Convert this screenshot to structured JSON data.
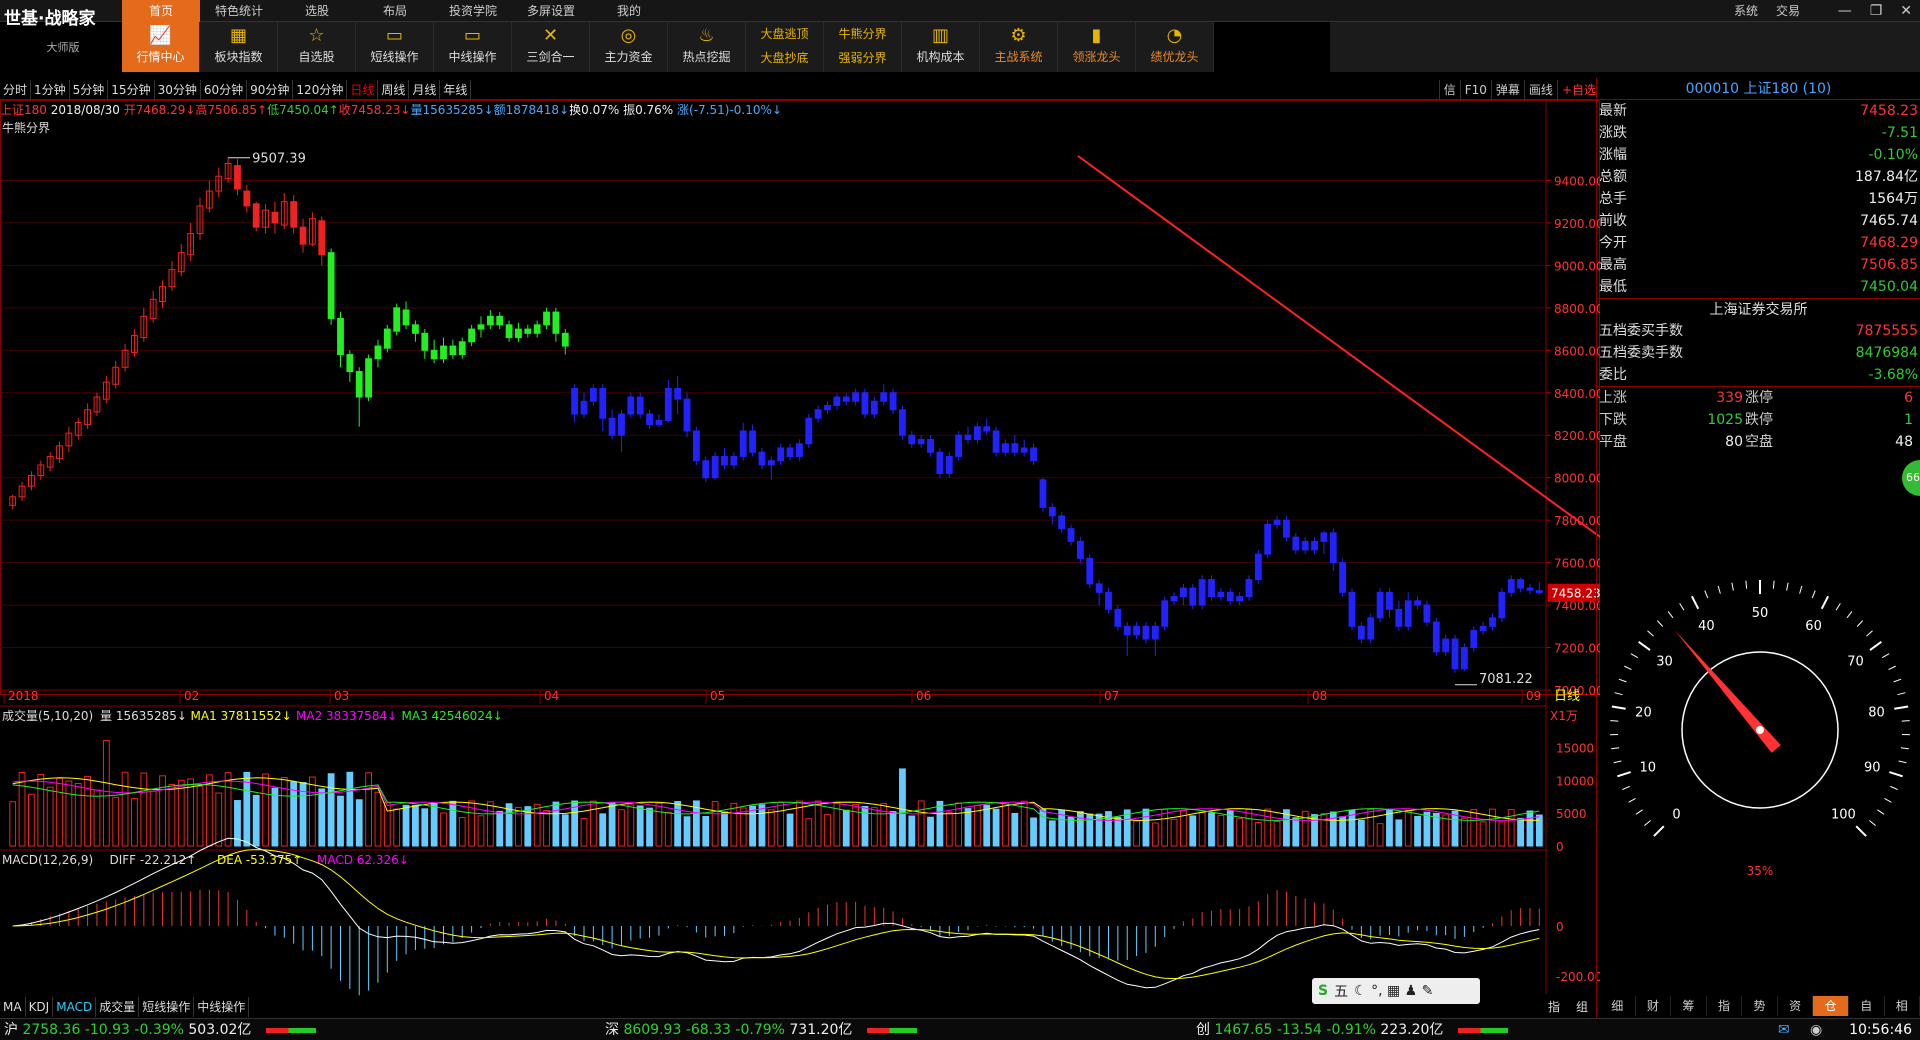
{
  "app": {
    "brand": "世基·战略家",
    "sub": "大师版"
  },
  "menu": [
    "首页",
    "特色统计",
    "选股",
    "布局",
    "投资学院",
    "多屏设置",
    "我的"
  ],
  "right_menu": [
    "系统",
    "交易"
  ],
  "toolbar": [
    {
      "label": "行情中心",
      "icon": "chart-icon",
      "active": true
    },
    {
      "label": "板块指数",
      "icon": "board-icon"
    },
    {
      "label": "自选股",
      "icon": "star-icon"
    },
    {
      "label": "短线操作",
      "icon": "short-icon"
    },
    {
      "label": "中线操作",
      "icon": "mid-icon"
    },
    {
      "label": "三剑合一",
      "icon": "swords-icon"
    },
    {
      "label": "主力资金",
      "icon": "money-icon"
    },
    {
      "label": "热点挖掘",
      "icon": "fire-icon"
    },
    {
      "label": "大盘逃顶",
      "label2": "大盘抄底"
    },
    {
      "label": "牛熊分界",
      "label2": "强弱分界"
    },
    {
      "label": "机构成本",
      "icon": "building-icon"
    },
    {
      "label": "主战系统",
      "icon": "gear-icon",
      "orange": true
    },
    {
      "label": "领涨龙头",
      "icon": "bars-icon",
      "orange": true
    },
    {
      "label": "绩优龙头",
      "icon": "pie-icon",
      "orange": true
    }
  ],
  "periods": [
    "分时",
    "1分钟",
    "5分钟",
    "15分钟",
    "30分钟",
    "60分钟",
    "90分钟",
    "120分钟",
    "日线",
    "周线",
    "月线",
    "年线"
  ],
  "active_period": "日线",
  "chart_tools": [
    "信",
    "F10",
    "弹幕",
    "画线",
    "+自选"
  ],
  "info": {
    "name": "上证180",
    "date": "2018/08/30",
    "open": "开7468.29↓",
    "high": "高7506.85↑",
    "low": "低7450.04↑",
    "close": "收7458.23↓",
    "vol": "量15635285↓",
    "amt": "额1878418↓",
    "turn": "换0.07%",
    "amp": "振0.76%",
    "chg": "涨(-7.51)-0.10%↓"
  },
  "indicator": "牛熊分界",
  "vol_info": {
    "title": "成交量(5,10,20)",
    "vol": "量 15635285↓",
    "ma1": "MA1 37811552↓",
    "ma2": "MA2 38337584↓",
    "ma3": "MA3 42546024↓",
    "unit": "X1万"
  },
  "macd_info": {
    "title": "MACD(12,26,9)",
    "diff": "DIFF -22.212↑",
    "dea": "DEA -53.375↑",
    "macd": "MACD 62.326↓"
  },
  "annotations": {
    "high": "9507.39",
    "low": "7081.22",
    "last": "7458.23",
    "period_label": "日线"
  },
  "price_axis": [
    "9400.00",
    "9200.00",
    "9000.00",
    "8800.00",
    "8600.00",
    "8400.00",
    "8200.00",
    "8000.00",
    "7800.00",
    "7600.00",
    "7400.00",
    "7200.00",
    "7000.00"
  ],
  "vol_axis": [
    "15000",
    "10000",
    "5000",
    "0"
  ],
  "macd_axis": [
    "0",
    "-200.00"
  ],
  "date_axis": [
    "2018",
    "02",
    "03",
    "04",
    "05",
    "06",
    "07",
    "08",
    "09"
  ],
  "quote": {
    "title": "000010 上证180 (10)",
    "rows": [
      {
        "label": "最新",
        "value": "7458.23",
        "color": "red"
      },
      {
        "label": "涨跌",
        "value": "-7.51",
        "color": "green"
      },
      {
        "label": "涨幅",
        "value": "-0.10%",
        "color": "green"
      },
      {
        "label": "总额",
        "value": "187.84亿",
        "color": "white"
      },
      {
        "label": "总手",
        "value": "1564万",
        "color": "white"
      },
      {
        "label": "前收",
        "value": "7465.74",
        "color": "white"
      },
      {
        "label": "今开",
        "value": "7468.29",
        "color": "red"
      },
      {
        "label": "最高",
        "value": "7506.85",
        "color": "red"
      },
      {
        "label": "最低",
        "value": "7450.04",
        "color": "green"
      }
    ],
    "exchange": "上海证券交易所",
    "rows2": [
      {
        "label": "五档委买手数",
        "value": "7875555",
        "color": "red"
      },
      {
        "label": "五档委卖手数",
        "value": "8476984",
        "color": "green"
      },
      {
        "label": "委比",
        "value": "-3.68%",
        "color": "green"
      }
    ],
    "stats": [
      {
        "l1": "上涨",
        "v1": "339",
        "l2": "涨停",
        "v2": "6",
        "c": "red"
      },
      {
        "l1": "下跌",
        "v1": "1025",
        "l2": "跌停",
        "v2": "1",
        "c": "green"
      },
      {
        "l1": "平盘",
        "v1": "80",
        "l2": "空盘",
        "v2": "48",
        "c": "white"
      }
    ]
  },
  "gauge": {
    "ticks": [
      "0",
      "10",
      "20",
      "30",
      "40",
      "50",
      "60",
      "70",
      "80",
      "90",
      "100"
    ],
    "value": 35,
    "value_label": "35%"
  },
  "badge": "66",
  "panel_tabs": [
    "细",
    "财",
    "筹",
    "指",
    "势",
    "资",
    "仓",
    "自",
    "相"
  ],
  "active_panel_tab": "仓",
  "sub_tabs": [
    "MA",
    "KDJ",
    "MACD",
    "成交量",
    "短线操作",
    "中线操作"
  ],
  "active_sub_tab": "MACD",
  "chart_btns": [
    "指",
    "组"
  ],
  "ime": {
    "s": "S",
    "label": "五",
    "icons": "☾ °, ▦ ♟ ✎"
  },
  "bottom": {
    "sh": {
      "label": "沪",
      "price": "2758.36",
      "chg": "-10.93",
      "pct": "-0.39%",
      "amt": "503.02亿"
    },
    "sz": {
      "label": "深",
      "price": "8609.93",
      "chg": "-68.33",
      "pct": "-0.79%",
      "amt": "731.20亿"
    },
    "cy": {
      "label": "创",
      "price": "1467.65",
      "chg": "-13.54",
      "pct": "-0.91%",
      "amt": "223.20亿"
    },
    "clock": "10:56:46"
  },
  "chart_data": {
    "type": "candlestick",
    "candles": [
      [
        7870,
        7910,
        7850,
        7920
      ],
      [
        7910,
        7960,
        7890,
        7980
      ],
      [
        7960,
        8010,
        7940,
        8030
      ],
      [
        8010,
        8060,
        7990,
        8080
      ],
      [
        8050,
        8100,
        8030,
        8120
      ],
      [
        8090,
        8150,
        8070,
        8170
      ],
      [
        8150,
        8210,
        8120,
        8240
      ],
      [
        8200,
        8260,
        8180,
        8280
      ],
      [
        8250,
        8320,
        8230,
        8350
      ],
      [
        8310,
        8380,
        8290,
        8400
      ],
      [
        8370,
        8450,
        8350,
        8480
      ],
      [
        8440,
        8520,
        8420,
        8550
      ],
      [
        8520,
        8600,
        8500,
        8630
      ],
      [
        8590,
        8670,
        8570,
        8700
      ],
      [
        8660,
        8760,
        8640,
        8800
      ],
      [
        8750,
        8840,
        8730,
        8880
      ],
      [
        8830,
        8900,
        8800,
        8930
      ],
      [
        8900,
        8980,
        8880,
        9020
      ],
      [
        8970,
        9060,
        8950,
        9100
      ],
      [
        9050,
        9150,
        9020,
        9200
      ],
      [
        9150,
        9280,
        9120,
        9320
      ],
      [
        9270,
        9350,
        9250,
        9400
      ],
      [
        9350,
        9420,
        9320,
        9460
      ],
      [
        9410,
        9480,
        9390,
        9507
      ],
      [
        9470,
        9360,
        9330,
        9500
      ],
      [
        9350,
        9280,
        9250,
        9380
      ],
      [
        9290,
        9180,
        9160,
        9300
      ],
      [
        9180,
        9260,
        9150,
        9290
      ],
      [
        9250,
        9200,
        9150,
        9300
      ],
      [
        9190,
        9300,
        9170,
        9340
      ],
      [
        9300,
        9180,
        9150,
        9330
      ],
      [
        9180,
        9100,
        9060,
        9220
      ],
      [
        9100,
        9220,
        9090,
        9250
      ],
      [
        9210,
        9050,
        9000,
        9230
      ],
      [
        9060,
        8750,
        8720,
        9080
      ],
      [
        8750,
        8580,
        8520,
        8780
      ],
      [
        8580,
        8500,
        8450,
        8600
      ],
      [
        8500,
        8380,
        8240,
        8520
      ],
      [
        8380,
        8560,
        8360,
        8580
      ],
      [
        8560,
        8620,
        8520,
        8650
      ],
      [
        8610,
        8700,
        8590,
        8720
      ],
      [
        8690,
        8800,
        8670,
        8820
      ],
      [
        8790,
        8720,
        8700,
        8830
      ],
      [
        8720,
        8680,
        8640,
        8740
      ],
      [
        8680,
        8600,
        8560,
        8700
      ],
      [
        8600,
        8560,
        8540,
        8650
      ],
      [
        8560,
        8620,
        8540,
        8660
      ],
      [
        8620,
        8580,
        8560,
        8650
      ],
      [
        8580,
        8640,
        8560,
        8660
      ],
      [
        8640,
        8700,
        8620,
        8720
      ],
      [
        8700,
        8720,
        8660,
        8760
      ],
      [
        8720,
        8760,
        8700,
        8790
      ],
      [
        8760,
        8720,
        8700,
        8780
      ],
      [
        8720,
        8660,
        8640,
        8740
      ],
      [
        8660,
        8700,
        8640,
        8730
      ],
      [
        8700,
        8680,
        8660,
        8720
      ],
      [
        8680,
        8720,
        8660,
        8740
      ],
      [
        8720,
        8780,
        8700,
        8800
      ],
      [
        8780,
        8680,
        8640,
        8800
      ],
      [
        8680,
        8620,
        8580,
        8700
      ],
      [
        8420,
        8300,
        8260,
        8440
      ],
      [
        8300,
        8360,
        8280,
        8400
      ],
      [
        8360,
        8420,
        8340,
        8440
      ],
      [
        8420,
        8280,
        8220,
        8440
      ],
      [
        8280,
        8200,
        8180,
        8320
      ],
      [
        8200,
        8300,
        8120,
        8320
      ],
      [
        8300,
        8380,
        8280,
        8400
      ],
      [
        8380,
        8300,
        8280,
        8400
      ],
      [
        8300,
        8250,
        8230,
        8320
      ],
      [
        8250,
        8270,
        8240,
        8300
      ],
      [
        8270,
        8420,
        8260,
        8460
      ],
      [
        8420,
        8370,
        8300,
        8480
      ],
      [
        8370,
        8220,
        8190,
        8400
      ],
      [
        8220,
        8080,
        8060,
        8240
      ],
      [
        8080,
        8000,
        7980,
        8100
      ],
      [
        8000,
        8100,
        7990,
        8120
      ],
      [
        8100,
        8060,
        8040,
        8140
      ],
      [
        8060,
        8100,
        8040,
        8120
      ],
      [
        8100,
        8220,
        8080,
        8260
      ],
      [
        8220,
        8120,
        8100,
        8250
      ],
      [
        8120,
        8060,
        8040,
        8140
      ],
      [
        8060,
        8080,
        7990,
        8100
      ],
      [
        8080,
        8140,
        8060,
        8160
      ],
      [
        8140,
        8100,
        8080,
        8160
      ],
      [
        8100,
        8160,
        8080,
        8180
      ],
      [
        8160,
        8280,
        8140,
        8300
      ],
      [
        8280,
        8320,
        8260,
        8340
      ],
      [
        8320,
        8340,
        8300,
        8360
      ],
      [
        8340,
        8380,
        8320,
        8400
      ],
      [
        8380,
        8360,
        8340,
        8400
      ],
      [
        8360,
        8400,
        8340,
        8420
      ],
      [
        8400,
        8300,
        8280,
        8420
      ],
      [
        8300,
        8360,
        8280,
        8380
      ],
      [
        8360,
        8400,
        8340,
        8440
      ],
      [
        8400,
        8320,
        8300,
        8420
      ],
      [
        8320,
        8200,
        8180,
        8340
      ],
      [
        8200,
        8160,
        8140,
        8220
      ],
      [
        8160,
        8180,
        8140,
        8200
      ],
      [
        8180,
        8120,
        8100,
        8200
      ],
      [
        8120,
        8020,
        8000,
        8140
      ],
      [
        8020,
        8100,
        8000,
        8120
      ],
      [
        8100,
        8200,
        8080,
        8220
      ],
      [
        8200,
        8180,
        8160,
        8240
      ],
      [
        8180,
        8240,
        8160,
        8260
      ],
      [
        8240,
        8220,
        8200,
        8280
      ],
      [
        8220,
        8120,
        8100,
        8240
      ],
      [
        8120,
        8160,
        8100,
        8180
      ],
      [
        8160,
        8120,
        8100,
        8200
      ],
      [
        8120,
        8140,
        8100,
        8180
      ],
      [
        8140,
        8080,
        8060,
        8160
      ],
      [
        7990,
        7860,
        7840,
        8000
      ],
      [
        7860,
        7820,
        7780,
        7880
      ],
      [
        7820,
        7760,
        7740,
        7840
      ],
      [
        7760,
        7700,
        7680,
        7780
      ],
      [
        7700,
        7620,
        7600,
        7720
      ],
      [
        7620,
        7500,
        7480,
        7640
      ],
      [
        7500,
        7460,
        7400,
        7520
      ],
      [
        7460,
        7380,
        7360,
        7480
      ],
      [
        7380,
        7300,
        7280,
        7400
      ],
      [
        7300,
        7260,
        7160,
        7320
      ],
      [
        7260,
        7300,
        7240,
        7320
      ],
      [
        7300,
        7240,
        7220,
        7320
      ],
      [
        7240,
        7300,
        7160,
        7320
      ],
      [
        7300,
        7420,
        7280,
        7440
      ],
      [
        7420,
        7440,
        7400,
        7460
      ],
      [
        7440,
        7480,
        7400,
        7500
      ],
      [
        7480,
        7400,
        7380,
        7500
      ],
      [
        7400,
        7520,
        7380,
        7540
      ],
      [
        7520,
        7440,
        7420,
        7540
      ],
      [
        7440,
        7460,
        7420,
        7480
      ],
      [
        7460,
        7420,
        7400,
        7480
      ],
      [
        7420,
        7440,
        7400,
        7460
      ],
      [
        7440,
        7520,
        7420,
        7540
      ],
      [
        7520,
        7640,
        7500,
        7660
      ],
      [
        7640,
        7780,
        7620,
        7800
      ],
      [
        7780,
        7800,
        7760,
        7820
      ],
      [
        7800,
        7720,
        7700,
        7820
      ],
      [
        7720,
        7660,
        7640,
        7740
      ],
      [
        7660,
        7700,
        7640,
        7720
      ],
      [
        7700,
        7660,
        7640,
        7720
      ],
      [
        7700,
        7740,
        7640,
        7750
      ],
      [
        7740,
        7600,
        7560,
        7760
      ],
      [
        7600,
        7460,
        7440,
        7620
      ],
      [
        7460,
        7300,
        7280,
        7480
      ],
      [
        7300,
        7240,
        7220,
        7320
      ],
      [
        7240,
        7340,
        7220,
        7360
      ],
      [
        7340,
        7460,
        7320,
        7480
      ],
      [
        7460,
        7380,
        7340,
        7480
      ],
      [
        7380,
        7300,
        7280,
        7420
      ],
      [
        7300,
        7420,
        7280,
        7460
      ],
      [
        7420,
        7400,
        7380,
        7440
      ],
      [
        7400,
        7320,
        7300,
        7420
      ],
      [
        7320,
        7180,
        7160,
        7340
      ],
      [
        7180,
        7240,
        7160,
        7260
      ],
      [
        7240,
        7100,
        7081,
        7260
      ],
      [
        7100,
        7200,
        7090,
        7220
      ],
      [
        7200,
        7280,
        7180,
        7300
      ],
      [
        7280,
        7300,
        7260,
        7320
      ],
      [
        7300,
        7340,
        7280,
        7360
      ],
      [
        7340,
        7460,
        7320,
        7480
      ],
      [
        7460,
        7520,
        7440,
        7540
      ],
      [
        7520,
        7480,
        7460,
        7530
      ],
      [
        7480,
        7470,
        7450,
        7500
      ],
      [
        7468,
        7458,
        7450,
        7507
      ]
    ],
    "volume_pattern": "daily volume bars in 万",
    "ylim": [
      7000,
      9600
    ],
    "x_ticks": [
      "2018",
      "02",
      "03",
      "04",
      "05",
      "06",
      "07",
      "08",
      "09"
    ],
    "high_label": "9507.39",
    "low_label": "7081.22"
  }
}
